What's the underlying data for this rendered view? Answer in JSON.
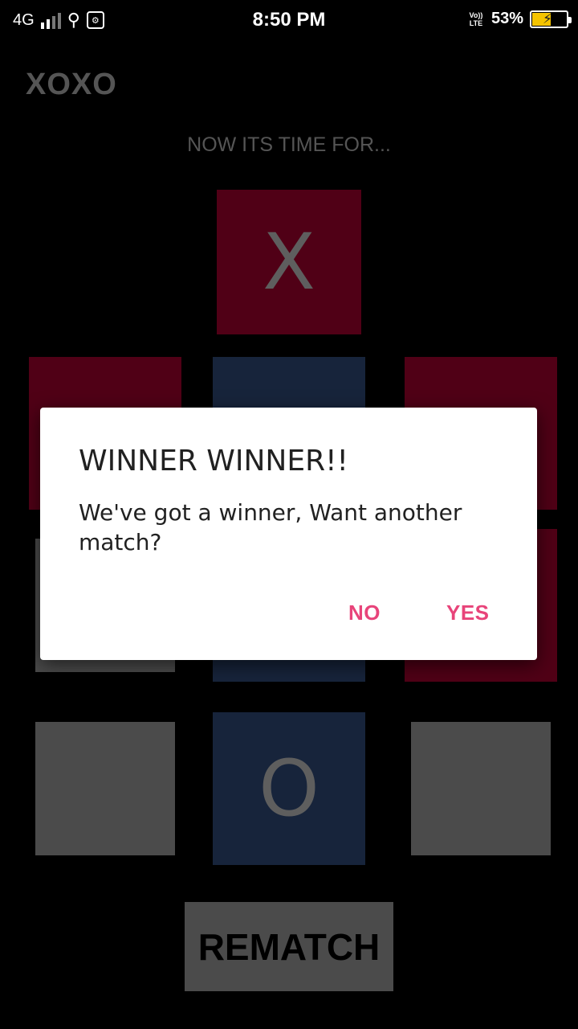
{
  "status_bar": {
    "network": "4G",
    "time": "8:50 PM",
    "volte": "Vo))\nLTE",
    "battery": "53%",
    "battery_level": 0.53
  },
  "app": {
    "title": "XOXO",
    "turn_text": "NOW ITS TIME FOR..."
  },
  "board": {
    "cells": [
      {
        "mark": "X",
        "color": "red"
      },
      {
        "mark": "",
        "color": "red"
      },
      {
        "mark": "",
        "color": "blue"
      },
      {
        "mark": "",
        "color": "red"
      },
      {
        "mark": "",
        "color": "grey"
      },
      {
        "mark": "",
        "color": "blue"
      },
      {
        "mark": "",
        "color": "red"
      },
      {
        "mark": "",
        "color": "grey"
      },
      {
        "mark": "O",
        "color": "blue"
      },
      {
        "mark": "",
        "color": "grey"
      }
    ],
    "colors": {
      "red": "#500016",
      "blue": "#17243b",
      "grey": "#4b4b4b"
    }
  },
  "rematch_label": "REMATCH",
  "dialog": {
    "title": "WINNER WINNER!!",
    "message": "We've got a winner, Want another match?",
    "no_label": "NO",
    "yes_label": "YES",
    "accent": "#e8447a"
  }
}
